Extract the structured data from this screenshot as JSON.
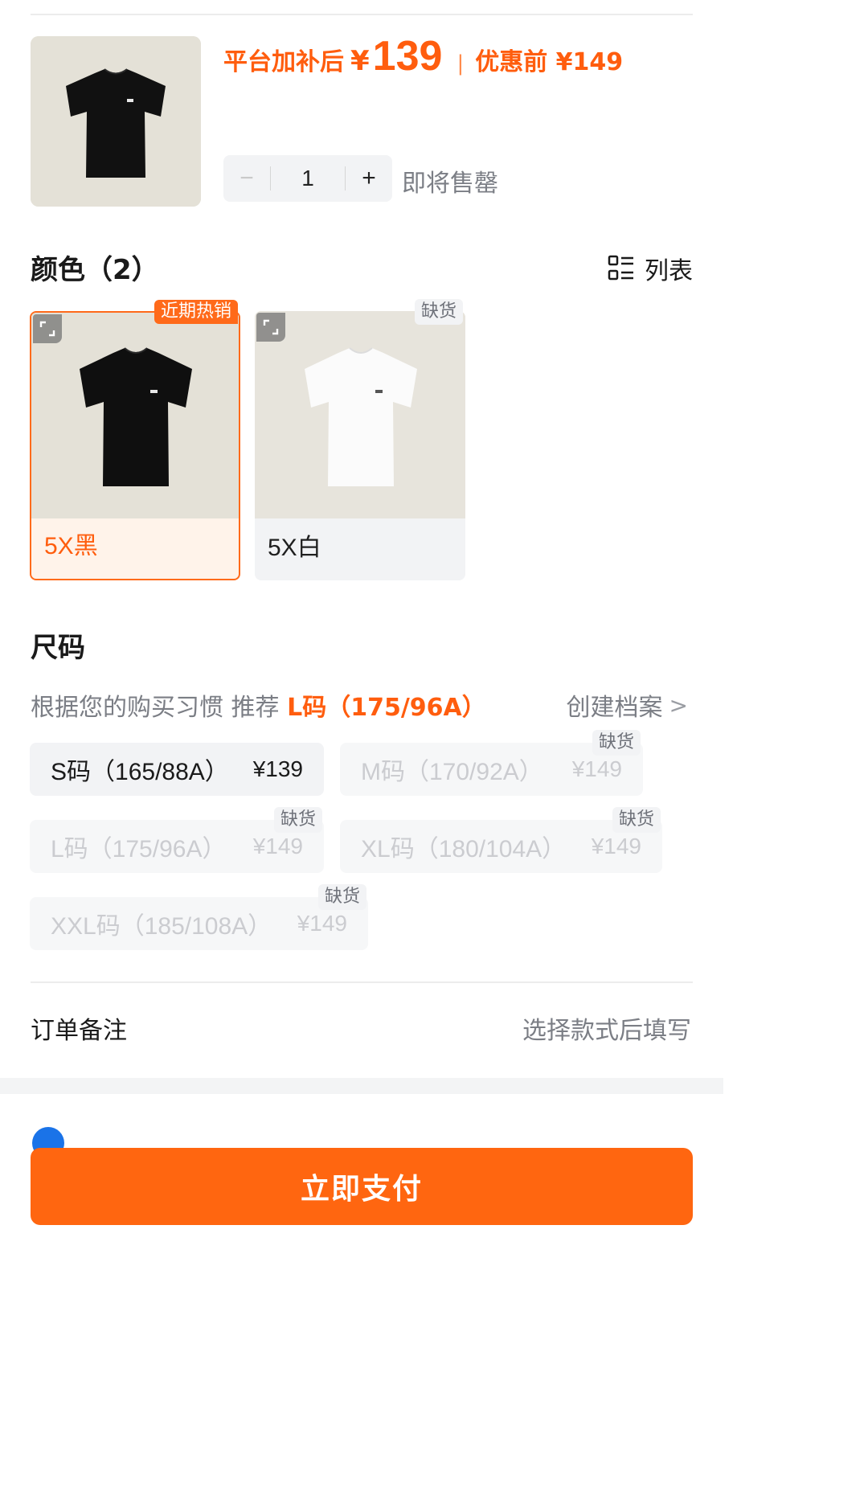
{
  "product": {
    "price_label": "平台加补后",
    "currency": "¥",
    "price": "139",
    "separator": "|",
    "original_price": "优惠前 ¥149",
    "image_icon": "black-tshirt-image"
  },
  "quantity": {
    "minus": "−",
    "value": "1",
    "plus": "+",
    "stock_note": "即将售罄"
  },
  "color_section": {
    "title": "颜色（2）",
    "list_toggle_label": "列表",
    "list_toggle_icon": "list-view-icon",
    "options": [
      {
        "label": "5X黑",
        "badge": "近期热销",
        "selected": true,
        "shirt_color": "#0f0f0f"
      },
      {
        "label": "5X白",
        "badge": "缺货",
        "selected": false,
        "shirt_color": "#fbfbfb"
      }
    ]
  },
  "size_section": {
    "title": "尺码",
    "recommend_prefix": "根据您的购买习惯 推荐 ",
    "recommend_size": "L码（175/96A）",
    "create_profile": "创建档案",
    "create_profile_chevron": ">",
    "options": [
      {
        "name": "S码（165/88A）",
        "price": "¥139",
        "available": true,
        "badge": ""
      },
      {
        "name": "M码（170/92A）",
        "price": "¥149",
        "available": false,
        "badge": "缺货"
      },
      {
        "name": "L码（175/96A）",
        "price": "¥149",
        "available": false,
        "badge": "缺货"
      },
      {
        "name": "XL码（180/104A）",
        "price": "¥149",
        "available": false,
        "badge": "缺货"
      },
      {
        "name": "XXL码（185/108A）",
        "price": "¥149",
        "available": false,
        "badge": "缺货"
      }
    ]
  },
  "order_note": {
    "label": "订单备注",
    "hint": "选择款式后填写"
  },
  "pay_button": {
    "label": "立即支付"
  },
  "colors": {
    "accent": "#ff6610",
    "price": "#ff5d0e",
    "muted_text": "#7b7e85",
    "chip_bg": "#f2f3f5"
  }
}
